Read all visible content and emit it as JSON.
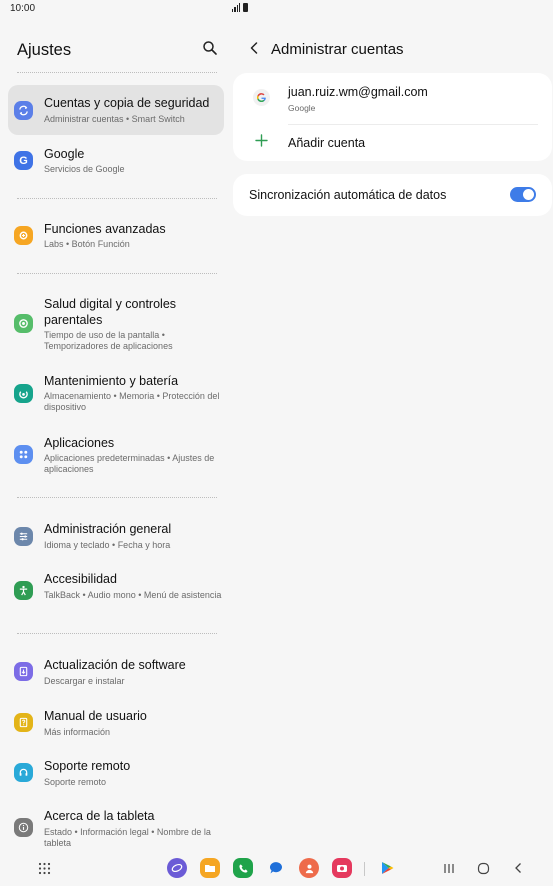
{
  "status": {
    "time": "10:00"
  },
  "left": {
    "title": "Ajustes",
    "items": [
      {
        "title": "Cuentas y copia de seguridad",
        "subtitle": "Administrar cuentas • Smart Switch",
        "icon": "sync-icon",
        "color": "#5b7fe8",
        "active": true
      },
      {
        "title": "Google",
        "subtitle": "Servicios de Google",
        "icon": "google-g-icon",
        "color": "#3f73e6"
      },
      {
        "title": "Funciones avanzadas",
        "subtitle": "Labs • Botón Función",
        "icon": "gear-plus-icon",
        "color": "#f6a623"
      },
      {
        "title": "Salud digital y controles parentales",
        "subtitle": "Tiempo de uso de la pantalla • Temporizadores de aplicaciones",
        "icon": "digital-wellbeing-icon",
        "color": "#56bd6a"
      },
      {
        "title": "Mantenimiento y batería",
        "subtitle": "Almacenamiento • Memoria • Protección del dispositivo",
        "icon": "device-care-icon",
        "color": "#16a48c"
      },
      {
        "title": "Aplicaciones",
        "subtitle": "Aplicaciones predeterminadas • Ajustes de aplicaciones",
        "icon": "apps-grid-icon",
        "color": "#5d8ff0"
      },
      {
        "title": "Administración general",
        "subtitle": "Idioma y teclado • Fecha y hora",
        "icon": "sliders-icon",
        "color": "#6c87ab"
      },
      {
        "title": "Accesibilidad",
        "subtitle": "TalkBack • Audio mono • Menú de asistencia",
        "icon": "accessibility-icon",
        "color": "#2f9d54"
      },
      {
        "title": "Actualización de software",
        "subtitle": "Descargar e instalar",
        "icon": "software-update-icon",
        "color": "#7c6ce6"
      },
      {
        "title": "Manual de usuario",
        "subtitle": "Más información",
        "icon": "user-manual-icon",
        "color": "#e3b418"
      },
      {
        "title": "Soporte remoto",
        "subtitle": "Soporte remoto",
        "icon": "headset-icon",
        "color": "#29a9d8"
      },
      {
        "title": "Acerca de la tableta",
        "subtitle": "Estado • Información legal • Nombre de la tableta",
        "icon": "info-icon",
        "color": "#7a7a7a"
      }
    ]
  },
  "right": {
    "title": "Administrar cuentas",
    "account": {
      "email": "juan.ruiz.wm@gmail.com",
      "provider": "Google"
    },
    "add_account": "Añadir cuenta",
    "sync": {
      "label": "Sincronización automática de datos",
      "enabled": true
    }
  },
  "colors": {
    "accent": "#3e7ce8",
    "background": "#f6f6f6",
    "card": "#ffffff",
    "active_item": "#e3e3e3"
  }
}
